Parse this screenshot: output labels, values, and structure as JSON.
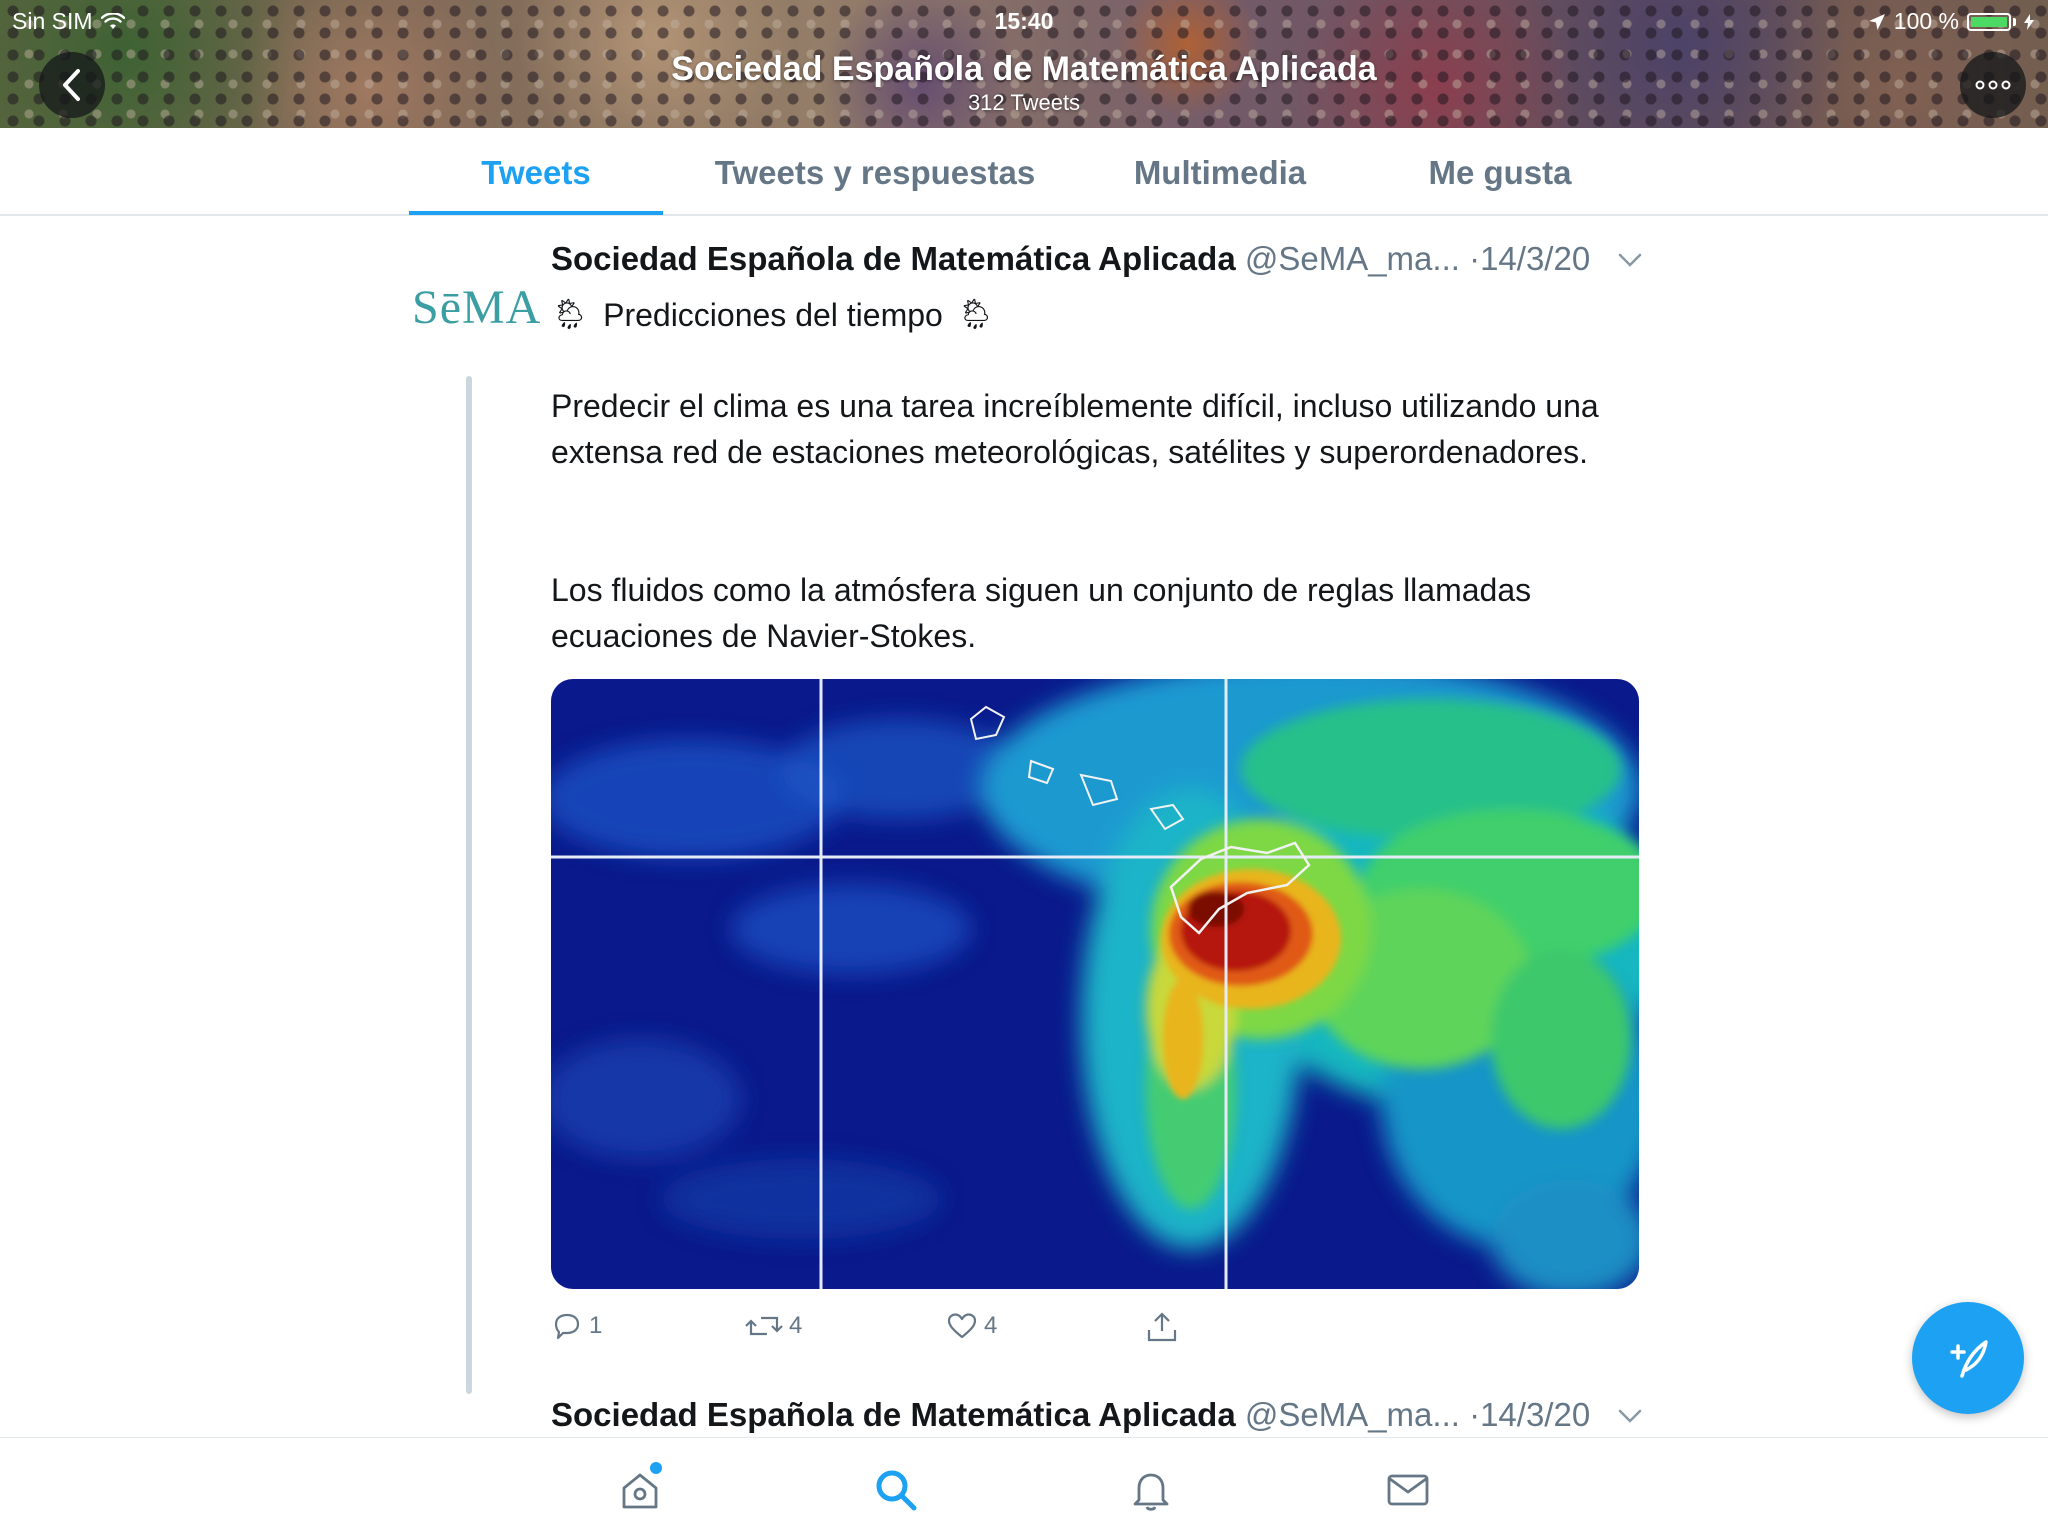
{
  "status_bar": {
    "carrier": "Sin SIM",
    "time": "15:40",
    "battery": "100 %",
    "battery_level": 1.0
  },
  "profile_header": {
    "title": "Sociedad Española de Matemática Aplicada",
    "tweet_count": "312 Tweets"
  },
  "tabs": [
    {
      "label": "Tweets",
      "active": true
    },
    {
      "label": "Tweets y respuestas",
      "active": false
    },
    {
      "label": "Multimedia",
      "active": false
    },
    {
      "label": "Me gusta",
      "active": false
    }
  ],
  "tweets": [
    {
      "avatar_text": "SēMA",
      "name": "Sociedad Española de Matemática Aplicada",
      "handle": "@SeMA_ma...",
      "date": "·14/3/20",
      "title_emoji": "🌦",
      "title": "Predicciones del tiempo",
      "paragraphs": [
        "Predecir el clima es una tarea increíblemente difícil, incluso utilizando una extensa red de estaciones meteorológicas, satélites y superordenadores.",
        "Los fluidos como la atmósfera siguen un conjunto de reglas llamadas ecuaciones de Navier-Stokes."
      ],
      "media_icon": "satellite-weather-map",
      "actions": {
        "replies": "1",
        "retweets": "4",
        "likes": "4"
      }
    },
    {
      "name": "Sociedad Española de Matemática Aplicada",
      "handle": "@SeMA_ma...",
      "date": "·14/3/20"
    }
  ],
  "colors": {
    "accent": "#1da1f2",
    "text": "#14171a",
    "secondary": "#657786",
    "border": "#e1e8ed"
  },
  "icons": {
    "back": "chevron-left-icon",
    "more": "more-icon",
    "reply": "reply-icon",
    "retweet": "retweet-icon",
    "like": "heart-icon",
    "share": "share-icon",
    "compose": "compose-icon",
    "nav": [
      "home-icon",
      "search-icon",
      "bell-icon",
      "mail-icon"
    ]
  }
}
